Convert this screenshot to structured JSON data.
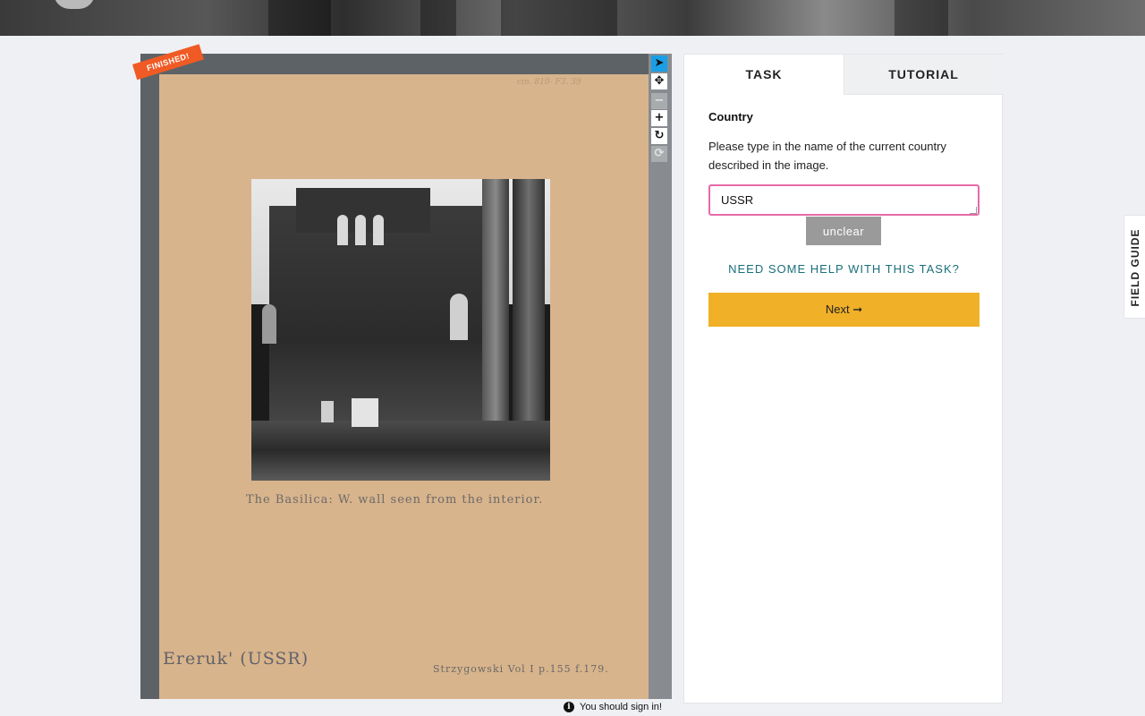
{
  "viewer": {
    "status_ribbon": "FINISHED!",
    "subject": {
      "catalog_note": "cin. 810- F3. 39",
      "caption": "The Basilica: W. wall seen from the interior.",
      "corner_left": "Ereruk' (USSR)",
      "corner_right": "Strzygowski Vol I p.155 f.179."
    },
    "toolbar": [
      {
        "name": "annotate",
        "icon": "pointer-icon",
        "glyph": "➤"
      },
      {
        "name": "move",
        "icon": "move-icon",
        "glyph": "✥"
      },
      {
        "name": "zoom-out",
        "icon": "zoom-out-icon",
        "glyph": "−"
      },
      {
        "name": "zoom-in",
        "icon": "zoom-in-icon",
        "glyph": "+"
      },
      {
        "name": "rotate",
        "icon": "rotate-icon",
        "glyph": "↻"
      },
      {
        "name": "reset",
        "icon": "reset-icon",
        "glyph": "⟳"
      }
    ],
    "signin_notice": "You should sign in!"
  },
  "task_panel": {
    "tabs": [
      "TASK",
      "TUTORIAL"
    ],
    "question_title": "Country",
    "question_text": "Please type in the name of the current country described in the image.",
    "answer_value": "USSR",
    "unclear_label": "unclear",
    "help_link": "NEED SOME HELP WITH THIS TASK?",
    "next_label": "Next ➞"
  },
  "field_guide_label": "FIELD GUIDE",
  "colors": {
    "accent_next": "#f0b027",
    "input_border": "#e66aa8",
    "help_link": "#1a6f7a",
    "ribbon": "#f05a24",
    "active_tool": "#1a9ee6"
  }
}
